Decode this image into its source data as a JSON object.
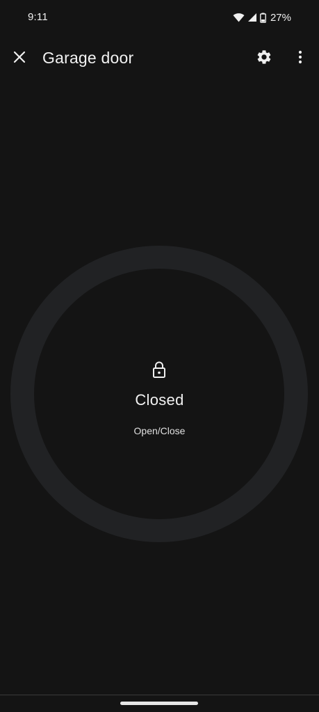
{
  "status_bar": {
    "time": "9:11",
    "battery_percent": "27%",
    "icons": [
      "wifi-icon",
      "cell-signal-icon",
      "battery-icon"
    ]
  },
  "app_bar": {
    "title": "Garage door",
    "icons": [
      "close-icon",
      "gear-icon",
      "more-vert-icon"
    ]
  },
  "device": {
    "state": "Closed",
    "action": "Open/Close",
    "state_icon": "lock-icon"
  },
  "colors": {
    "background": "#141414",
    "ring": "#212224",
    "text": "#f2f2f2"
  }
}
